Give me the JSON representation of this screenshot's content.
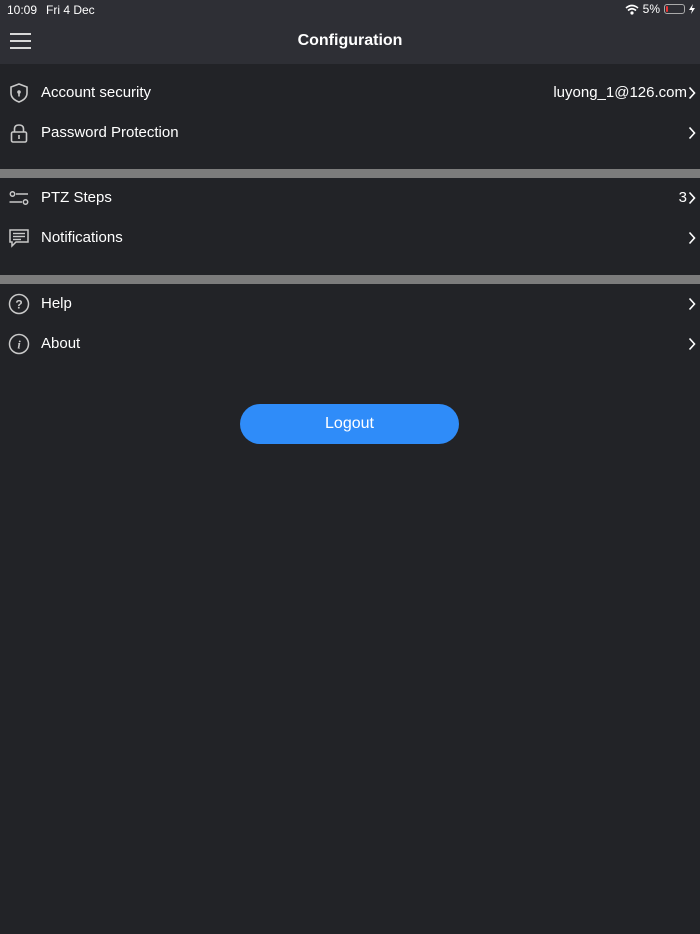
{
  "status_bar": {
    "time": "10:09",
    "date": "Fri 4 Dec",
    "battery": "5%"
  },
  "header": {
    "title": "Configuration",
    "menu_icon": "hamburger-menu-icon"
  },
  "groups": [
    {
      "items": [
        {
          "label": "Account security",
          "value": "luyong_1@126.com",
          "icon": "shield-icon"
        },
        {
          "label": "Password Protection",
          "value": "",
          "icon": "lock-icon"
        }
      ]
    },
    {
      "items": [
        {
          "label": "PTZ Steps",
          "value": "3",
          "icon": "sliders-icon"
        },
        {
          "label": "Notifications",
          "value": "",
          "icon": "message-icon"
        }
      ]
    },
    {
      "items": [
        {
          "label": "Help",
          "value": "",
          "icon": "help-icon"
        },
        {
          "label": "About",
          "value": "",
          "icon": "info-icon"
        }
      ]
    }
  ],
  "logout": {
    "label": "Logout"
  },
  "colors": {
    "background": "#222327",
    "header": "#2e2f35",
    "divider": "#7c7c7c",
    "accent": "#2f8cf9"
  }
}
